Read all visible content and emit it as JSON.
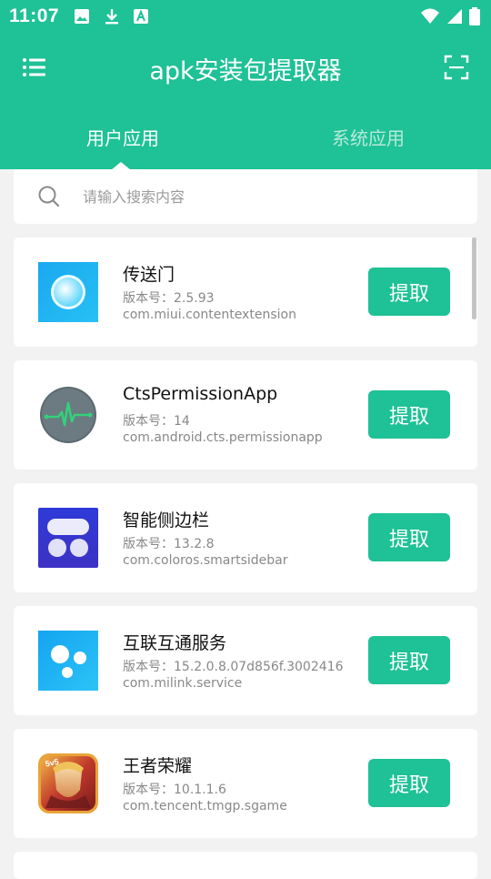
{
  "status_bar": {
    "time": "11:07",
    "icons": [
      "image-icon",
      "download-icon",
      "text-badge-icon",
      "wifi-icon",
      "signal-icon",
      "battery-icon"
    ]
  },
  "toolbar": {
    "title": "apk安装包提取器",
    "menu_icon": "menu-icon",
    "scan_icon": "scan-icon"
  },
  "tabs": [
    {
      "label": "用户应用",
      "active": true
    },
    {
      "label": "系统应用",
      "active": false
    }
  ],
  "search": {
    "placeholder": "请输入搜索内容",
    "value": ""
  },
  "apps": [
    {
      "name": "传送门",
      "version": "版本号：2.5.93",
      "package": "com.miui.contentextension",
      "button": "提取",
      "icon": "portal-icon"
    },
    {
      "name": "CtsPermissionApp",
      "version": "版本号：14",
      "package": "com.android.cts.permissionapp",
      "button": "提取",
      "icon": "pulse-icon"
    },
    {
      "name": "智能侧边栏",
      "version": "版本号：13.2.8",
      "package": "com.coloros.smartsidebar",
      "button": "提取",
      "icon": "sidebar-icon"
    },
    {
      "name": "互联互通服务",
      "version": "版本号：15.2.0.8.07d856f.3002416",
      "package": "com.milink.service",
      "button": "提取",
      "icon": "milink-icon"
    },
    {
      "name": "王者荣耀",
      "version": "版本号：10.1.1.6",
      "package": "com.tencent.tmgp.sgame",
      "button": "提取",
      "icon": "game-icon"
    }
  ],
  "colors": {
    "primary": "#1fc196",
    "background": "#f2f2f2"
  }
}
